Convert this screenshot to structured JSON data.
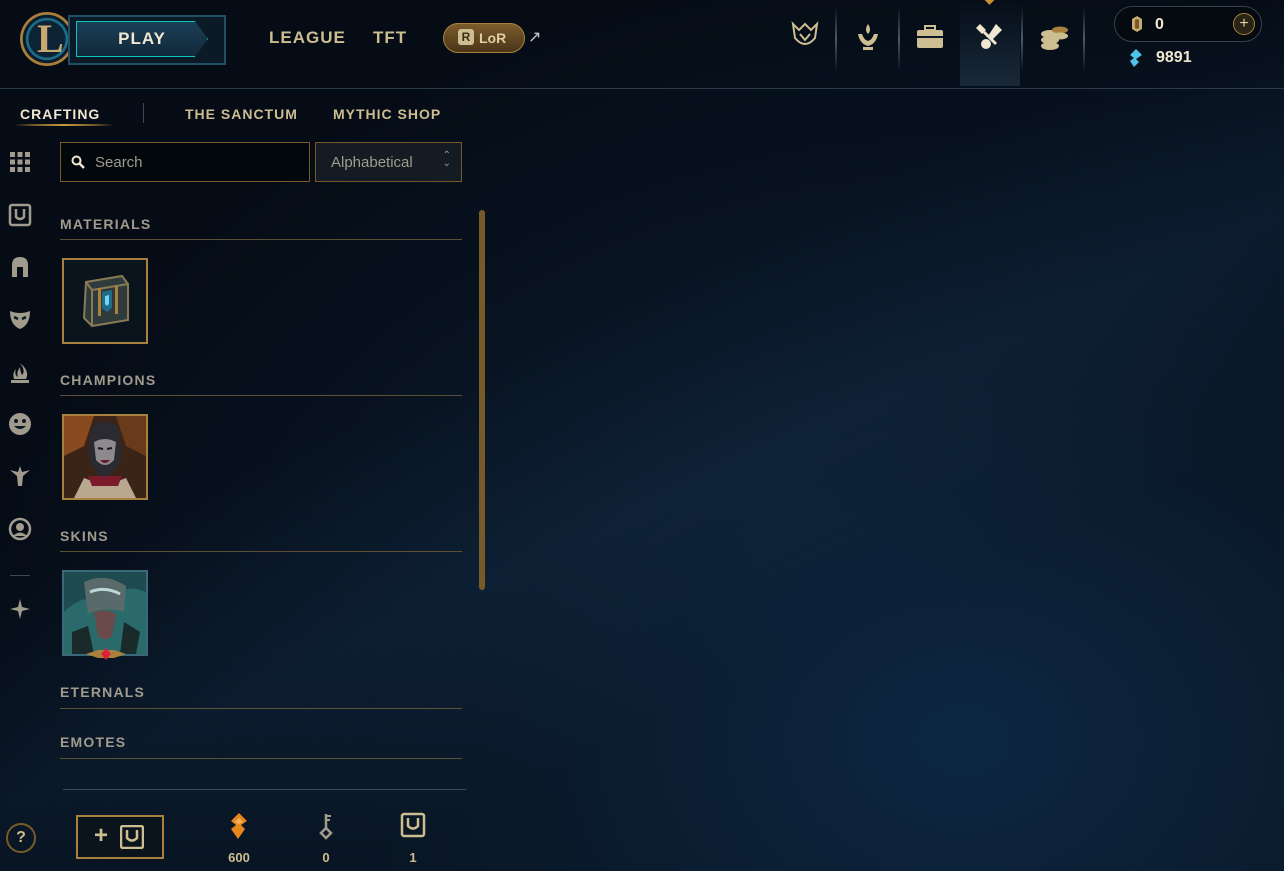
{
  "header": {
    "play_label": "PLAY",
    "nav": [
      "LEAGUE",
      "TFT"
    ],
    "lor_label": "LoR",
    "lor_glyph": "R",
    "external_arrow": "↗",
    "icons": [
      "worlds-trophy-icon",
      "clash-trophy-icon",
      "collection-chest-icon",
      "loot-crafting-icon",
      "store-coins-icon"
    ],
    "active_icon": "loot-crafting-icon",
    "riot_points": "0",
    "riot_points_plus": "+",
    "blue_essence": "9891"
  },
  "subnav": {
    "tabs": [
      "CRAFTING",
      "THE SANCTUM",
      "MYTHIC SHOP"
    ],
    "active": "CRAFTING"
  },
  "sidebar": {
    "filters": [
      "all-grid-icon",
      "chest-icon",
      "champion-helmet-icon",
      "skin-mask-icon",
      "ward-flame-icon",
      "emote-face-icon",
      "eternal-statue-icon",
      "icon-avatar-icon",
      "ornn-spirit-icon"
    ],
    "help_label": "?"
  },
  "search": {
    "placeholder": "Search",
    "value": ""
  },
  "sort": {
    "selected": "Alphabetical"
  },
  "sections": [
    {
      "title": "MATERIALS",
      "items": [
        "hextech-chest"
      ]
    },
    {
      "title": "CHAMPIONS",
      "items": [
        "champion-shard"
      ]
    },
    {
      "title": "SKINS",
      "items": [
        "skin-shard"
      ]
    },
    {
      "title": "ETERNALS",
      "items": []
    },
    {
      "title": "EMOTES",
      "items": []
    }
  ],
  "footer": {
    "add_label": "+",
    "orange_essence": "600",
    "keys": "0",
    "chests": "1"
  },
  "colors": {
    "gold": "#c8aa6e",
    "gold_dark": "#785a28",
    "text": "#cdbe91",
    "text_muted": "#a09b8c",
    "teal": "#0ac8b9",
    "background": "#050c16",
    "orange_essence": "#e8861e",
    "blue_essence": "#4fc4e8"
  }
}
